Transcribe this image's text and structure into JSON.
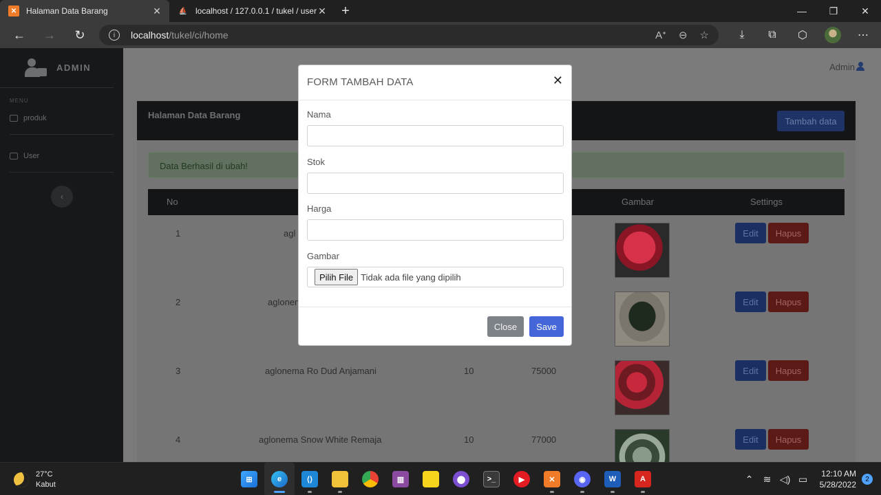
{
  "browser": {
    "tabs": [
      {
        "title": "Halaman Data Barang",
        "favicon": "xampp-icon"
      },
      {
        "title": "localhost / 127.0.0.1 / tukel / user",
        "favicon": "phpmyadmin-icon"
      }
    ],
    "url_host": "localhost",
    "url_path": "/tukel/ci/home"
  },
  "sidebar": {
    "brand": "ADMIN",
    "menu_heading": "MENU",
    "items": [
      {
        "label": "produk"
      },
      {
        "label": "User"
      }
    ]
  },
  "topnav": {
    "user": "Admin"
  },
  "card": {
    "title": "Halaman Data Barang",
    "add_button": "Tambah data"
  },
  "alert": {
    "text": "Data Berhasil di ubah!"
  },
  "table": {
    "headers": {
      "no": "No",
      "gambar": "Gambar",
      "settings": "Settings"
    },
    "rows": [
      {
        "no": "1",
        "nama": "agl",
        "stok": "",
        "harga": ""
      },
      {
        "no": "2",
        "nama": "aglonen",
        "stok": "",
        "harga": ""
      },
      {
        "no": "3",
        "nama": "aglonema Ro Dud Anjamani",
        "stok": "10",
        "harga": "75000"
      },
      {
        "no": "4",
        "nama": "aglonema Snow White Remaja",
        "stok": "10",
        "harga": "77000"
      }
    ],
    "edit_label": "Edit",
    "delete_label": "Hapus"
  },
  "modal": {
    "title": "FORM TAMBAH DATA",
    "fields": {
      "nama": {
        "label": "Nama",
        "value": ""
      },
      "stok": {
        "label": "Stok",
        "value": ""
      },
      "harga": {
        "label": "Harga",
        "value": ""
      },
      "gambar": {
        "label": "Gambar",
        "button": "Pilih File",
        "status": "Tidak ada file yang dipilih"
      }
    },
    "close_label": "Close",
    "save_label": "Save"
  },
  "taskbar": {
    "temp": "27°C",
    "weather": "Kabut",
    "time": "12:10 AM",
    "date": "5/28/2022",
    "notifications": "2"
  }
}
